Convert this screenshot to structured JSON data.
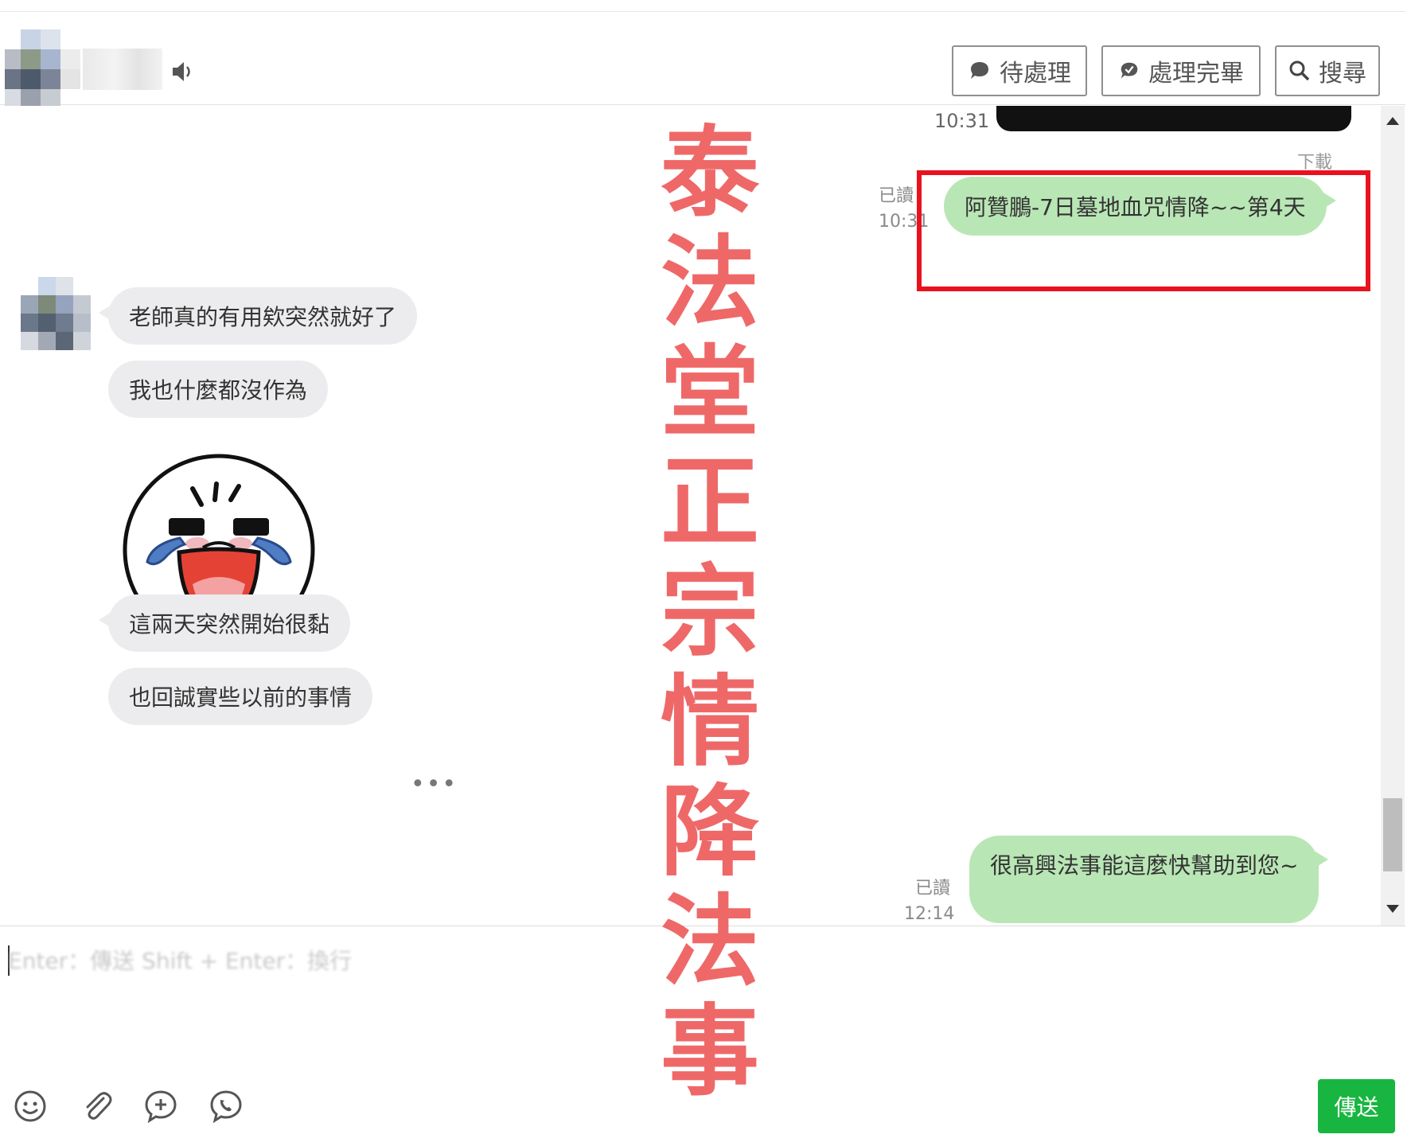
{
  "header": {
    "pending_label": "待處理",
    "done_label": "處理完畢",
    "search_label": "搜尋"
  },
  "messages": {
    "top_time": "10:31",
    "download_label": "下載",
    "outgoing_1": {
      "text": "阿贊鵬-7日墓地血咒情降~~第4天",
      "read_label": "已讀",
      "time": "10:31"
    },
    "incoming": [
      "老師真的有用欸突然就好了",
      "我也什麼都沒作為",
      "這兩天突然開始很黏",
      "也回誠實些以前的事情"
    ],
    "typing_indicator": "•••",
    "outgoing_2": {
      "text": "很高興法事能這麼快幫助到您~",
      "read_label": "已讀",
      "time": "12:14"
    }
  },
  "watermark": [
    "泰",
    "法",
    "堂",
    "正",
    "宗",
    "情",
    "降",
    "法",
    "事"
  ],
  "composer": {
    "placeholder": "Enter：傳送 Shift + Enter：換行",
    "send_label": "傳送"
  },
  "colors": {
    "outgoing_bubble": "#b9e6b5",
    "incoming_bubble": "#ececee",
    "send_button": "#18b640",
    "highlight": "#e8121e",
    "watermark": "#ef6868"
  },
  "icons": [
    "speaker-icon",
    "speech-bubble-icon",
    "check-bubble-icon",
    "search-icon",
    "emoji-icon",
    "paperclip-icon",
    "plus-bubble-icon",
    "phone-bubble-icon",
    "scroll-up-icon",
    "scroll-down-icon"
  ]
}
